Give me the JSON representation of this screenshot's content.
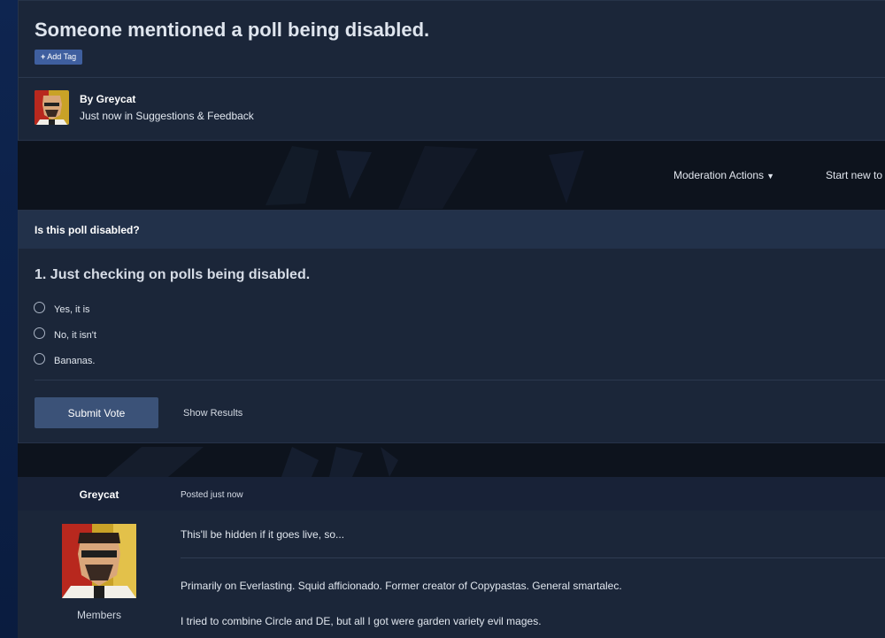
{
  "topic": {
    "title": "Someone mentioned a poll being disabled.",
    "add_tag_label": "Add Tag",
    "author_by": "By Greycat",
    "posted_time": "Just now",
    "posted_in": "in",
    "forum_name": "Suggestions & Feedback"
  },
  "actions": {
    "moderation_actions": "Moderation Actions",
    "start_new_topic": "Start new to"
  },
  "poll": {
    "title": "Is this poll disabled?",
    "question": "1. Just checking on polls being disabled.",
    "options": [
      {
        "label": "Yes, it is",
        "selected": false
      },
      {
        "label": "No, it isn't",
        "selected": false
      },
      {
        "label": "Bananas.",
        "selected": false
      }
    ],
    "submit_label": "Submit Vote",
    "show_results_label": "Show Results"
  },
  "post": {
    "author_name": "Greycat",
    "posted": "Posted just now",
    "group": "Members",
    "content": "This'll be hidden if it goes live, so...",
    "signature_lines": [
      "Primarily on Everlasting. Squid afficionado. Former creator of Copypastas. General smartalec.",
      "I tried to combine Circle and DE, but all I got were garden variety evil mages."
    ]
  },
  "colors": {
    "card_bg": "#1b2639",
    "poll_header_bg": "#22314a",
    "button_bg": "#3b5278",
    "tag_bg": "#3f5f9f"
  },
  "icons": [
    "plus-icon",
    "caret-down-icon",
    "radio-icon",
    "avatar-image"
  ]
}
